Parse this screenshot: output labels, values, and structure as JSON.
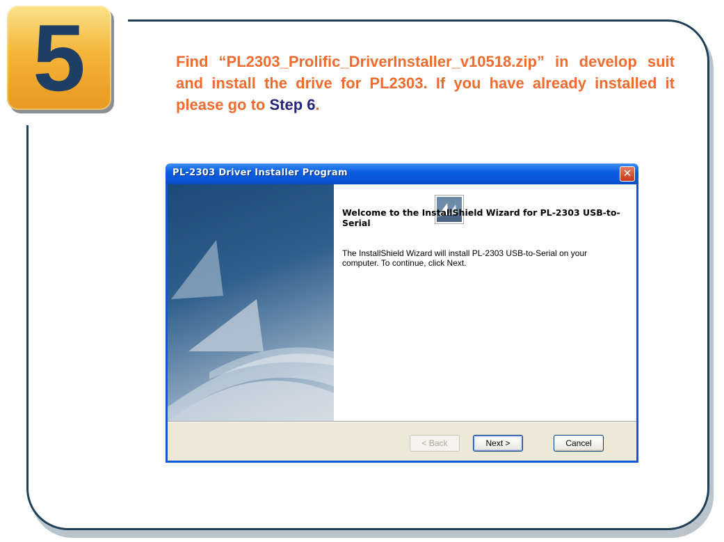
{
  "step": {
    "number": "5"
  },
  "instruction": {
    "text": "Find  “PL2303_Prolific_DriverInstaller_v10518.zip” in develop suit and install the drive for PL2303. If you have already installed it please go to ",
    "step_link": "Step 6",
    "end": "."
  },
  "dialog": {
    "title": "PL-2303 Driver Installer Program",
    "close_glyph": "✕",
    "welcome": "Welcome to the InstallShield Wizard for PL-2303 USB-to-Serial",
    "description": "The InstallShield Wizard will install PL-2303 USB-to-Serial on your computer.  To continue, click Next.",
    "buttons": {
      "back": "< Back",
      "next": "Next >",
      "cancel": "Cancel"
    }
  },
  "colors": {
    "instruction": "#ef6b2f",
    "step_link": "#23267a",
    "badge": "#f4b53a",
    "badge_number": "#1f3e63",
    "frame": "#1f3f57",
    "titlebar": "#0a5ee0"
  }
}
